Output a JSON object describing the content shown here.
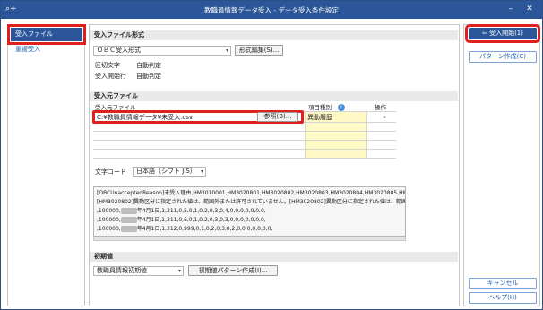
{
  "window": {
    "title": "教職員情報データ受入 - データ受入条件設定"
  },
  "sidebar": {
    "items": [
      {
        "label": "受入ファイル",
        "active": true
      },
      {
        "label": "重複受入",
        "active": false
      }
    ]
  },
  "format_section": {
    "header": "受入ファイル形式",
    "format_select": "ＯＢＣ受入形式",
    "edit_button": "形式編集(S)...",
    "delimiter_label": "区切文字",
    "delimiter_value": "自動判定",
    "start_row_label": "受入開始行",
    "start_row_value": "自動判定"
  },
  "source_section": {
    "header": "受入元ファイル",
    "col_file": "受入元ファイル",
    "col_type": "項目種別",
    "col_op": "操作",
    "file_path": "C:¥教職員情報データ¥未受入.csv",
    "browse_button": "参照(B)...",
    "item_type": "異動履歴",
    "charset_label": "文字コード",
    "charset_value": "日本語（シフト JIS）"
  },
  "log": {
    "lines": [
      "[OBCUnacceptedReason]未受入理由,HM3010001,HM3020801,HM3020802,HM3020803,HM3020804,HM3020805,HM3",
      "[HM3020802]異動区分に指定された値は、範囲外または許可されていません。[HM3020802]異動区分に指定された値は、範囲",
      ",100000,",
      ",100000,",
      ",100000,"
    ],
    "row_tails": [
      "年4月1日,1,311,0,5,0,1,0,2,0,3,0,4,0,0,0,0,0,0,0,",
      "年4月1日,1,311,0,6,0,1,0,2,0,3,0,3,0,0,0,0,0,0,0,",
      "年4月1日,1,312,0,999,0,1,0,2,0,3,0,2,0,0,0,0,0,0,0,"
    ]
  },
  "initial_section": {
    "header": "初期値",
    "initial_select": "教職員情報初期値",
    "create_button": "初期値パターン作成(I)..."
  },
  "actions": {
    "start_button": "受入開始(1)",
    "pattern_button": "パターン作成(C)",
    "cancel_button": "キャンセル",
    "help_button": "ヘルプ(H)"
  },
  "colors": {
    "accent": "#2b579a",
    "highlight": "#e0201c",
    "type_cell": "#fff9c6"
  }
}
